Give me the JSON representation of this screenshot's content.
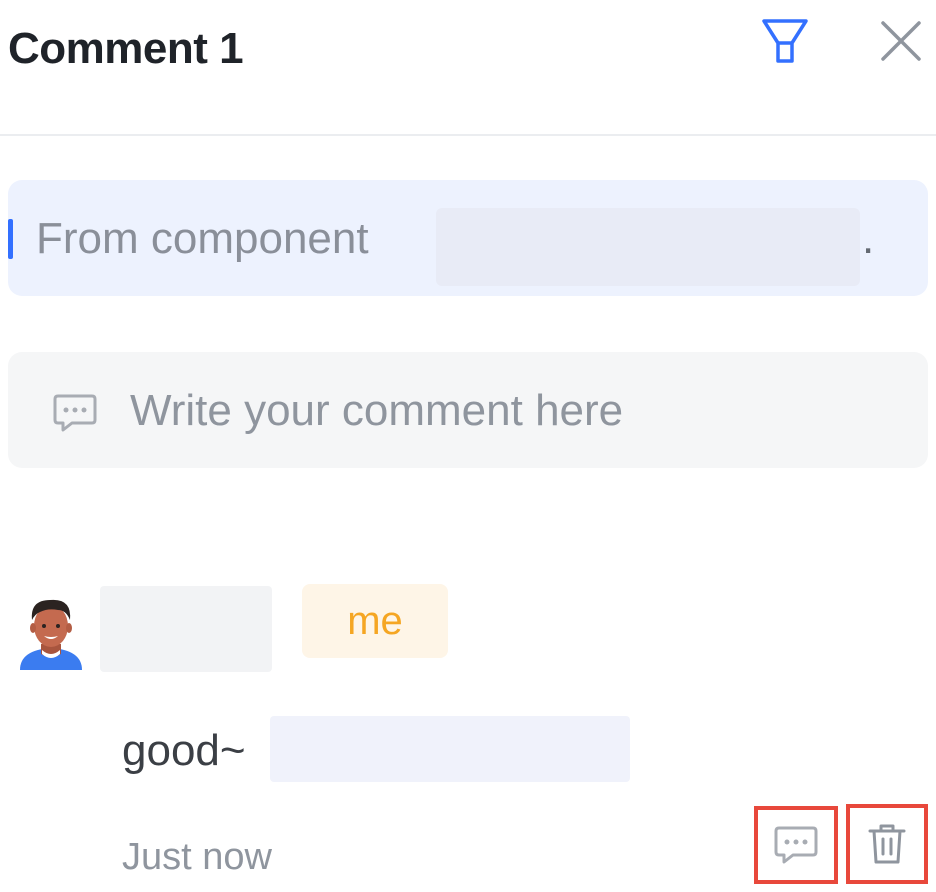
{
  "header": {
    "title": "Comment 1",
    "filter_icon": "filter-funnel-icon",
    "close_icon": "close-x-icon"
  },
  "source": {
    "label": "From component",
    "trailing": "."
  },
  "comment_input": {
    "placeholder": "Write your comment here",
    "icon": "comment-bubble-icon"
  },
  "comment": {
    "badge": "me",
    "text": "good~",
    "timestamp": "Just now",
    "actions": {
      "reply_icon": "reply-comment-icon",
      "delete_icon": "trash-icon"
    }
  },
  "colors": {
    "accent": "#3370ff",
    "badge_text": "#f5a623",
    "badge_bg": "#fef5e7",
    "highlight_border": "#e8483b"
  }
}
